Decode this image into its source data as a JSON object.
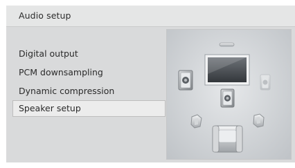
{
  "window": {
    "title": "Audio setup"
  },
  "menu": {
    "items": [
      {
        "label": "Digital output"
      },
      {
        "label": "PCM downsampling"
      },
      {
        "label": "Dynamic compression"
      },
      {
        "label": "Speaker setup"
      }
    ],
    "selected_index": 3
  },
  "illustration": {
    "icons": [
      "soundbar-icon",
      "tv-screen-icon",
      "front-left-speaker-icon",
      "center-speaker-icon",
      "front-right-speaker-icon",
      "surround-left-speaker-icon",
      "armchair-icon",
      "surround-right-speaker-icon"
    ]
  },
  "colors": {
    "background": "#d9dadb",
    "titlebar": "#e5e6e6",
    "selected_item": "#ececec",
    "selected_border": "#bdbdbd",
    "text": "#2a2a2a"
  }
}
